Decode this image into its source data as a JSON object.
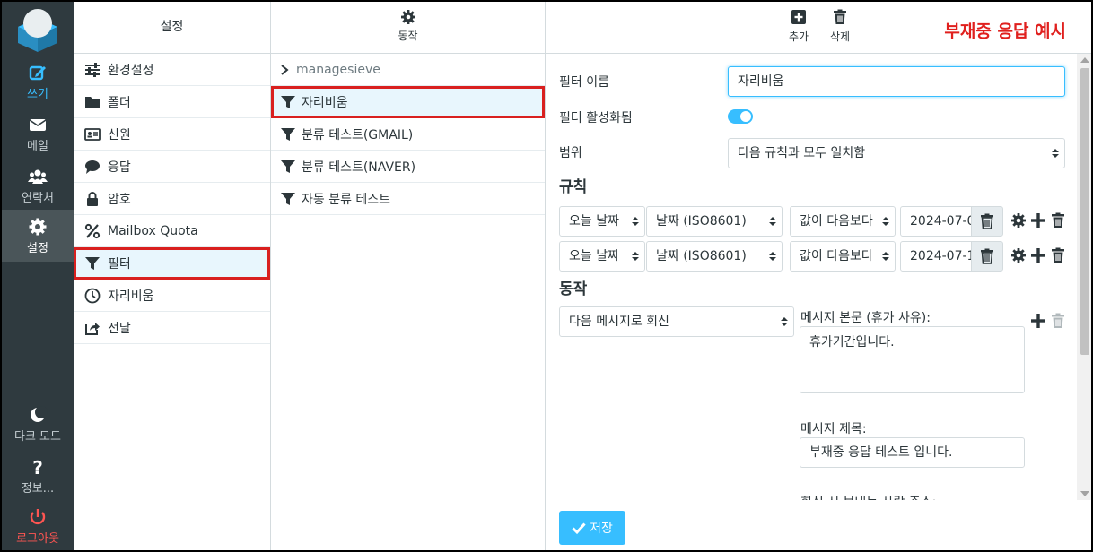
{
  "rail": {
    "compose": "쓰기",
    "mail": "메일",
    "contacts": "연락처",
    "settings": "설정",
    "dark_mode": "다크 모드",
    "about": "정보...",
    "logout": "로그아웃"
  },
  "settings_column": {
    "title": "설정",
    "items": [
      {
        "label": "환경설정",
        "icon": "sliders-icon"
      },
      {
        "label": "폴더",
        "icon": "folder-icon"
      },
      {
        "label": "신원",
        "icon": "id-card-icon"
      },
      {
        "label": "응답",
        "icon": "comment-icon"
      },
      {
        "label": "암호",
        "icon": "lock-icon"
      },
      {
        "label": "Mailbox Quota",
        "icon": "percent-icon"
      },
      {
        "label": "필터",
        "icon": "filter-icon",
        "selected": true
      },
      {
        "label": "자리비움",
        "icon": "clock-icon"
      },
      {
        "label": "전달",
        "icon": "forward-icon"
      }
    ]
  },
  "filters_column": {
    "actions_label": "동작",
    "filter_set": "managesieve",
    "filters": [
      {
        "label": "자리비움",
        "selected": true
      },
      {
        "label": "분류 테스트(GMAIL)"
      },
      {
        "label": "분류 테스트(NAVER)"
      },
      {
        "label": "자동 분류 테스트"
      }
    ]
  },
  "toolbar": {
    "add": "추가",
    "delete": "삭제",
    "caption": "부재중 응답 예시"
  },
  "form": {
    "filter_name_label": "필터 이름",
    "filter_name_value": "자리비움",
    "filter_enabled_label": "필터 활성화됨",
    "filter_enabled": true,
    "scope_label": "범위",
    "scope_value": "다음 규칙과 모두 일치함",
    "rules_heading": "규칙",
    "rules": [
      {
        "header": "오늘 날짜",
        "type": "날짜 (ISO8601)",
        "op": "값이 다음보다",
        "value": "2024-07-0"
      },
      {
        "header": "오늘 날짜",
        "type": "날짜 (ISO8601)",
        "op": "값이 다음보다",
        "value": "2024-07-1"
      }
    ],
    "actions_heading": "동작",
    "action_value": "다음 메시지로 회신",
    "body_label": "메시지 본문 (휴가 사유):",
    "body_value": "휴가기간입니다.",
    "subject_label": "메시지 제목:",
    "subject_value": "부재중 응답 테스트 입니다.",
    "sender_label": "회신 시 보내는 사람 주소:"
  },
  "save_label": "저장",
  "colors": {
    "accent": "#37beff",
    "rail_bg": "#2f3a3f",
    "highlight_red": "#d9201f",
    "caption_red": "#e0201e"
  }
}
